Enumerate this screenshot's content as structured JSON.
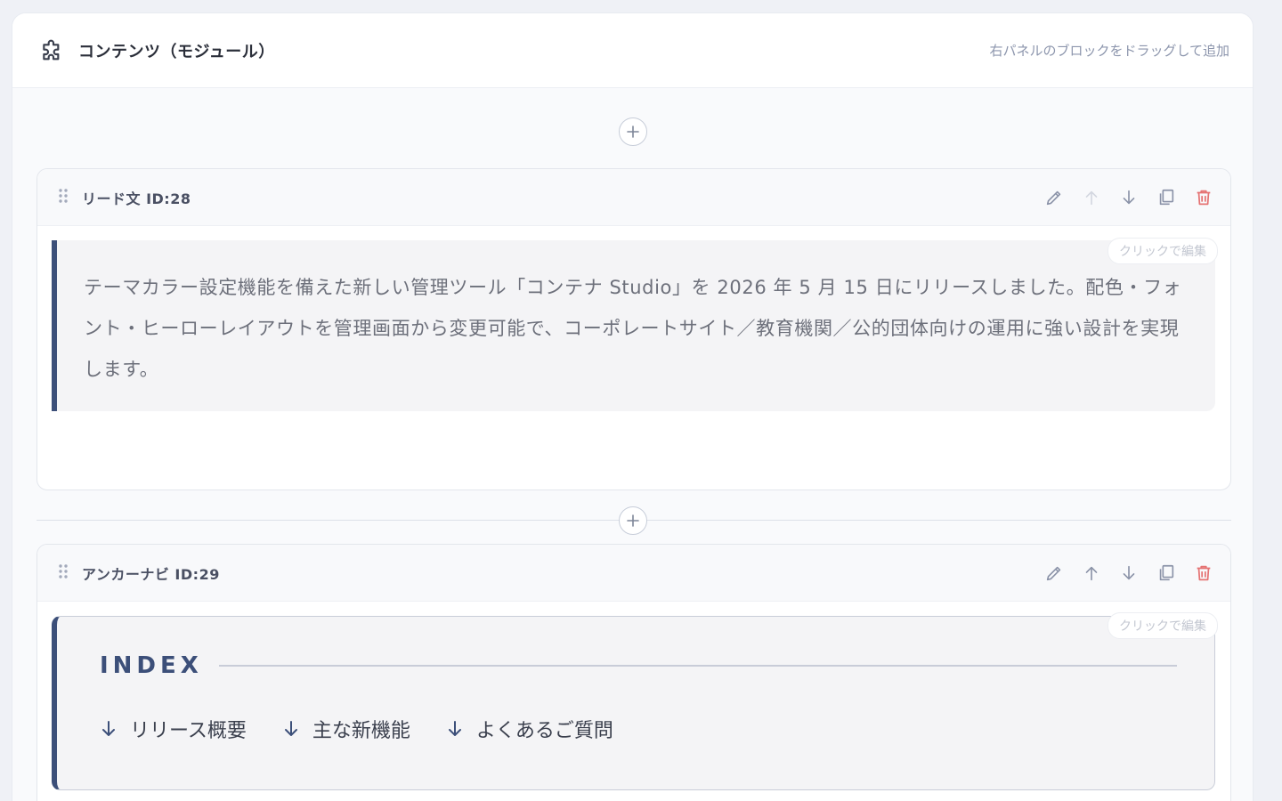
{
  "header": {
    "title": "コンテンツ（モジュール）",
    "hint": "右パネルのブロックをドラッグして追加",
    "icon": "puzzle-icon"
  },
  "blocks": [
    {
      "title": "リード文 ID:28",
      "edit_hint": "クリックで編集",
      "text": "テーマカラー設定機能を備えた新しい管理ツール「コンテナ Studio」を 2026 年 5 月 15 日にリリースしました。配色・フォント・ヒーローレイアウトを管理画面から変更可能で、コーポレートサイト／教育機関／公的団体向けの運用に強い設計を実現します。"
    },
    {
      "title": "アンカーナビ ID:29",
      "edit_hint": "クリックで編集",
      "index_title": "INDEX",
      "links": [
        "リリース概要",
        "主な新機能",
        "よくあるご質問"
      ]
    }
  ],
  "colors": {
    "accent": "#3c4f79",
    "delete": "#e57373",
    "muted_icon": "#9aa2b6"
  },
  "icons": [
    "puzzle-icon",
    "plus-icon",
    "drag-handle-icon",
    "pencil-icon",
    "arrow-up-icon",
    "arrow-down-icon",
    "copy-icon",
    "trash-icon"
  ]
}
